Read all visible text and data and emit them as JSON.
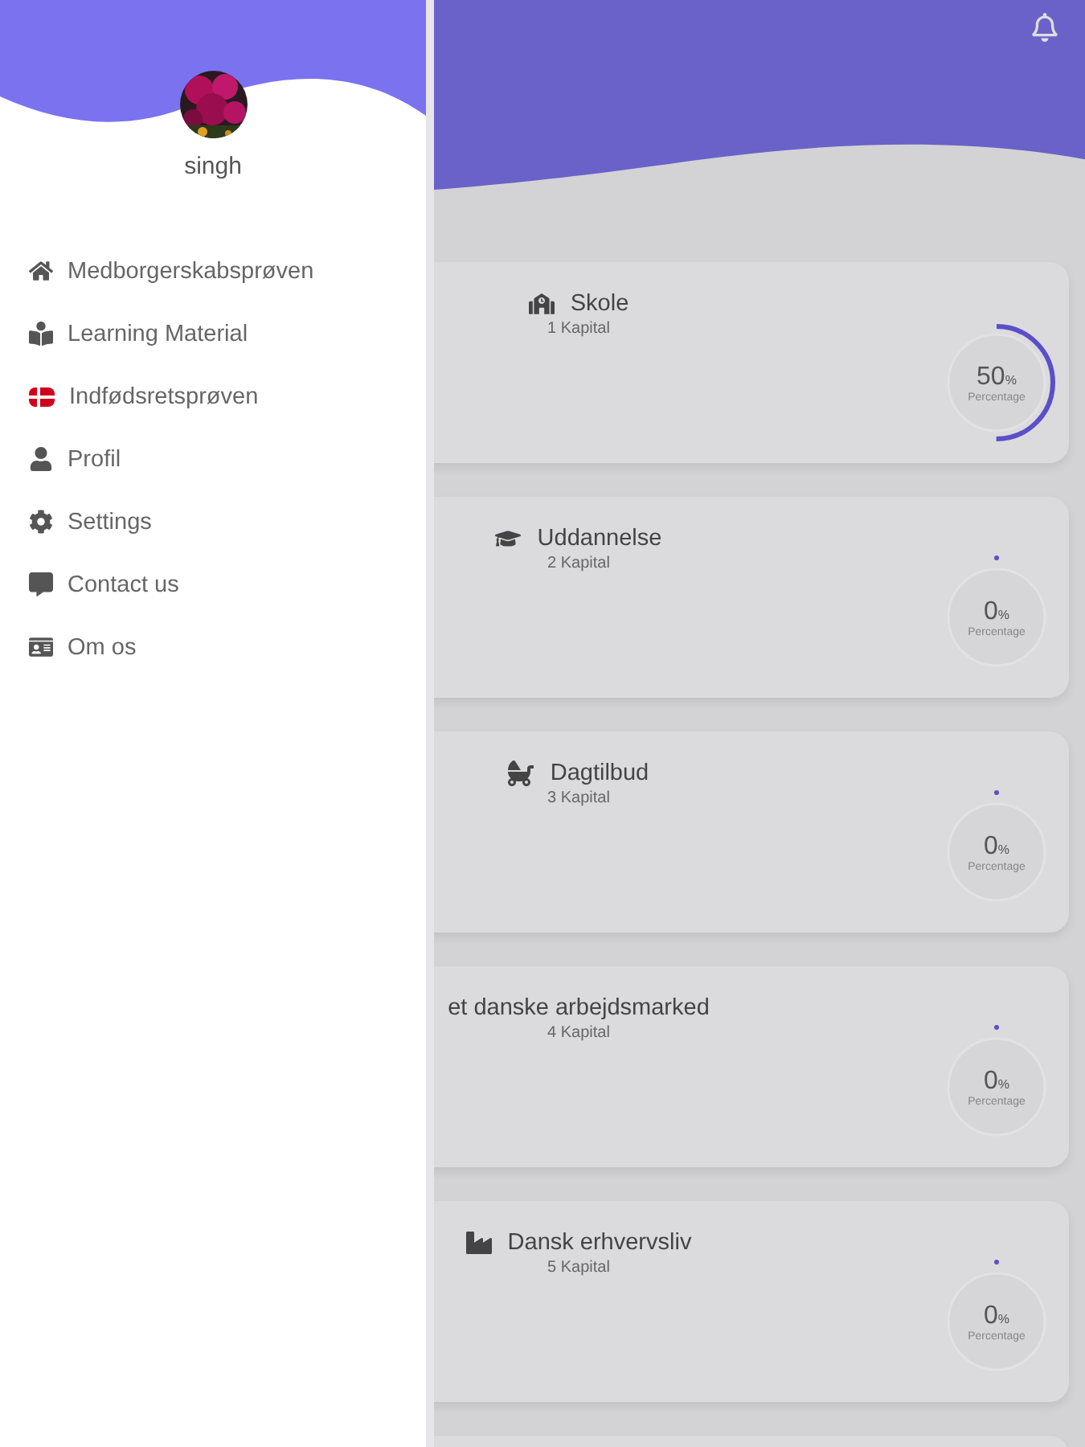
{
  "drawer": {
    "user_name": "singh",
    "items": [
      {
        "label": "Medborgerskabsprøven"
      },
      {
        "label": "Learning Material"
      },
      {
        "label": "Indfødsretsprøven"
      },
      {
        "label": "Profil"
      },
      {
        "label": "Settings"
      },
      {
        "label": "Contact us"
      },
      {
        "label": "Om os"
      }
    ]
  },
  "chapters": [
    {
      "title": "Skole",
      "subtitle": "1 Kapital",
      "value": "50",
      "unit": "%",
      "caption": "Percentage"
    },
    {
      "title": "Uddannelse",
      "subtitle": "2 Kapital",
      "value": "0",
      "unit": "%",
      "caption": "Percentage"
    },
    {
      "title": "Dagtilbud",
      "subtitle": "3 Kapital",
      "value": "0",
      "unit": "%",
      "caption": "Percentage"
    },
    {
      "title": "et danske arbejdsmarked",
      "subtitle": "4 Kapital",
      "value": "0",
      "unit": "%",
      "caption": "Percentage"
    },
    {
      "title": "Dansk erhvervsliv",
      "subtitle": "5 Kapital",
      "value": "0",
      "unit": "%",
      "caption": "Percentage"
    }
  ]
}
